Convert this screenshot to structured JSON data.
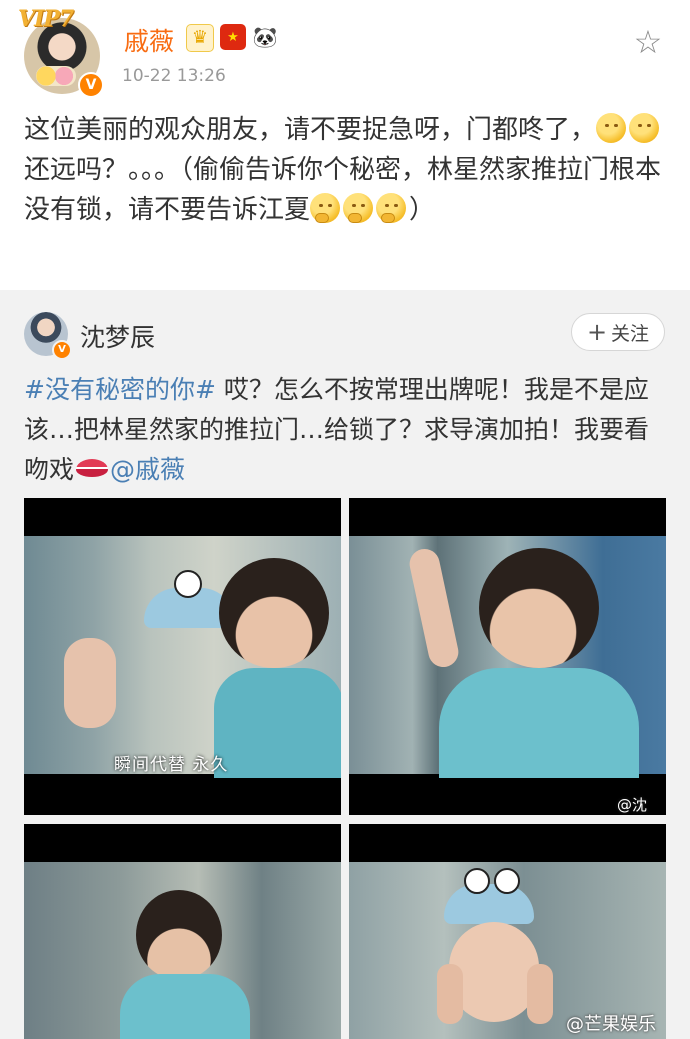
{
  "post": {
    "vip_badge": "VIP7",
    "username": "戚薇",
    "timestamp": "10-22 13:26",
    "text_part1": "这位美丽的观众朋友，请不要捉急呀，门都咚了，",
    "text_part2": "还远吗？。。。（偷偷告诉你个秘密，林星然家推拉门根本没有锁，请不要告诉江夏",
    "text_part3": "）",
    "badge_icons": [
      "crown-icon",
      "china-flag-icon",
      "panda-icon"
    ]
  },
  "repost": {
    "username": "沈梦辰",
    "follow_label": "关注",
    "follow_plus": "+",
    "hashtag": "#没有秘密的你#",
    "text_part1": " 哎？怎么不按常理出牌呢！我是不是应该…把林星然家的推拉门…给锁了？求导演加拍！我要看吻戏",
    "mention": "@戚薇"
  },
  "media": {
    "caption_1": "瞬间代替 永久",
    "watermark_2": "@沈"
  },
  "footer_watermark": "@芒果娱乐",
  "colors": {
    "username_orange": "#f86c12",
    "link_blue": "#4a7fb4",
    "verified_orange": "#ff8200",
    "repost_bg": "#f2f2f2"
  }
}
